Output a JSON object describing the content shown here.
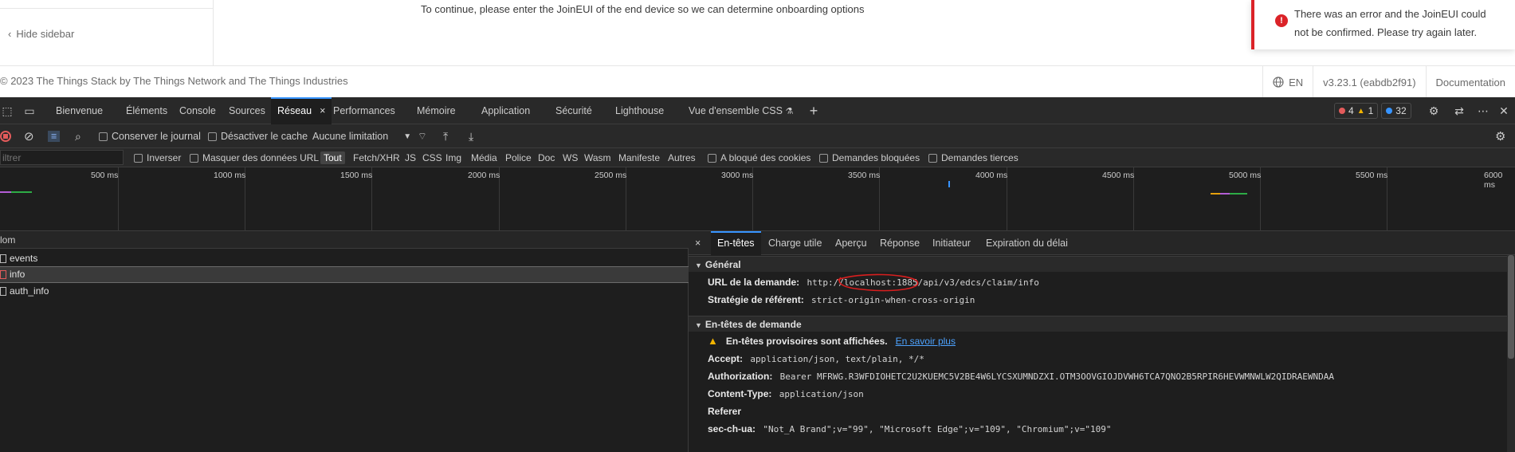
{
  "app": {
    "hide_sidebar": "Hide sidebar",
    "continue_text": "To continue, please enter the JoinEUI of the end device so we can determine onboarding options",
    "footer": {
      "copyright": "© 2023 The Things Stack by The Things Network and The Things Industries",
      "language": "EN",
      "version": "v3.23.1 (eabdb2f91)",
      "documentation": "Documentation"
    },
    "toast": {
      "message": "There was an error and the JoinEUI could not be confirmed. Please try again later.",
      "color": "#db2328"
    }
  },
  "devtools": {
    "tabs": [
      {
        "label": "Bienvenue"
      },
      {
        "label": "Éléments"
      },
      {
        "label": "Console"
      },
      {
        "label": "Sources"
      },
      {
        "label": "Réseau",
        "active": true
      },
      {
        "label": "Performances"
      },
      {
        "label": "Mémoire"
      },
      {
        "label": "Application"
      },
      {
        "label": "Sécurité"
      },
      {
        "label": "Lighthouse"
      },
      {
        "label": "Vue d'ensemble CSS"
      }
    ],
    "close_tab": "×",
    "badges": {
      "errors": "4",
      "warnings": "1",
      "info": "32"
    },
    "toolbar": {
      "preserve_log": "Conserver le journal",
      "disable_cache": "Désactiver le cache",
      "throttling": "Aucune limitation"
    },
    "filter": {
      "placeholder": "iltrer",
      "invert": "Inverser",
      "hide_data_urls": "Masquer des données URL",
      "types": [
        "Tout",
        "Fetch/XHR",
        "JS",
        "CSS",
        "Img",
        "Média",
        "Police",
        "Doc",
        "WS",
        "Wasm",
        "Manifeste",
        "Autres"
      ],
      "blocked_cookies": "A bloqué des cookies",
      "blocked_requests": "Demandes bloquées",
      "third_party": "Demandes tierces"
    },
    "overview": {
      "ticks": [
        "500 ms",
        "1000 ms",
        "1500 ms",
        "2000 ms",
        "2500 ms",
        "3000 ms",
        "3500 ms",
        "4000 ms",
        "4500 ms",
        "5000 ms",
        "5500 ms",
        "6000 ms"
      ]
    },
    "requests": {
      "header": "lom",
      "rows": [
        {
          "name": "events"
        },
        {
          "name": "info",
          "selected": true
        },
        {
          "name": "auth_info"
        }
      ]
    },
    "details": {
      "close": "×",
      "tabs": [
        "En-têtes",
        "Charge utile",
        "Aperçu",
        "Réponse",
        "Initiateur",
        "Expiration du délai"
      ],
      "general": {
        "title": "Général",
        "request_url_key": "URL de la demande:",
        "request_url": "http://localhost:1885/api/v3/edcs/claim/info",
        "referrer_key": "Stratégie de référent:",
        "referrer": "strict-origin-when-cross-origin"
      },
      "request_headers": {
        "title": "En-têtes de demande",
        "warning": "En-têtes provisoires sont affichées.",
        "learn_more": "En savoir plus",
        "accept_key": "Accept:",
        "accept": "application/json, text/plain, */*",
        "authorization_key": "Authorization:",
        "authorization": "Bearer MFRWG.R3WFDIOHETC2U2KUEMC5V2BE4W6LYCSXUMNDZXI.OTM3OOVGIOJDVWH6TCA7QNO2B5RPIR6HEVWMNWLW2QIDRAEWNDAA",
        "content_type_key": "Content-Type:",
        "content_type": "application/json",
        "referer_key": "Referer",
        "sec_ch_ua_key": "sec-ch-ua:",
        "sec_ch_ua": "\"Not_A Brand\";v=\"99\", \"Microsoft Edge\";v=\"109\", \"Chromium\";v=\"109\""
      }
    }
  }
}
